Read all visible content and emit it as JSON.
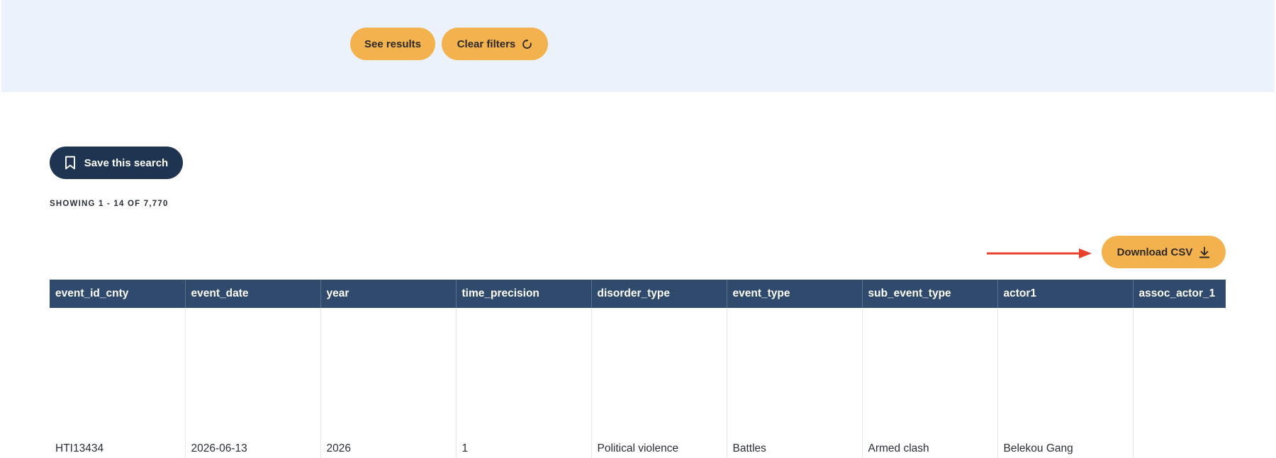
{
  "filters": {
    "see_results_label": "See results",
    "clear_filters_label": "Clear filters",
    "clear_filters_icon": "refresh-icon"
  },
  "save_search": {
    "label": "Save this search",
    "icon": "bookmark-icon"
  },
  "results": {
    "showing_text": "SHOWING 1 - 14 OF 7,770"
  },
  "download": {
    "label": "Download CSV",
    "icon": "download-icon"
  },
  "annotation": {
    "arrow_color": "#e8412c"
  },
  "colors": {
    "accent": "#f4b24e",
    "navy": "#1f3451",
    "table_header": "#2f4a6c",
    "band": "#ecf2fb"
  },
  "table": {
    "columns": [
      "event_id_cnty",
      "event_date",
      "year",
      "time_precision",
      "disorder_type",
      "event_type",
      "sub_event_type",
      "actor1",
      "assoc_actor_1"
    ],
    "rows": [
      [
        "HTI13434",
        "2026-06-13",
        "2026",
        "1",
        "Political violence",
        "Battles",
        "Armed clash",
        "Belekou Gang",
        ""
      ]
    ]
  }
}
